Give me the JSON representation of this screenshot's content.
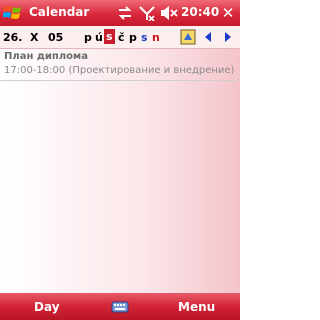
{
  "titlebar": {
    "app_title": "Calendar",
    "time": "20:40",
    "close_label": "✕"
  },
  "datebar": {
    "day": "26.",
    "month": "X",
    "year": "05",
    "weekdays": [
      {
        "label": "p",
        "color": "#000000"
      },
      {
        "label": "ú",
        "color": "#000000"
      },
      {
        "label": "s",
        "color": "#ffffff",
        "selected": true
      },
      {
        "label": "č",
        "color": "#000000"
      },
      {
        "label": "p",
        "color": "#000000"
      },
      {
        "label": "s",
        "color": "#1a3cc8"
      },
      {
        "label": "n",
        "color": "#d01818"
      }
    ]
  },
  "appointment": {
    "title": "План диплома",
    "time": "17:00-18:00",
    "location": "(Проектирование и внедрение)"
  },
  "softkeys": {
    "left": "Day",
    "right": "Menu"
  },
  "colors": {
    "accent": "#d8283a",
    "selected_day": "#c81e2e",
    "saturday": "#1a3cc8",
    "sunday": "#d01818"
  }
}
